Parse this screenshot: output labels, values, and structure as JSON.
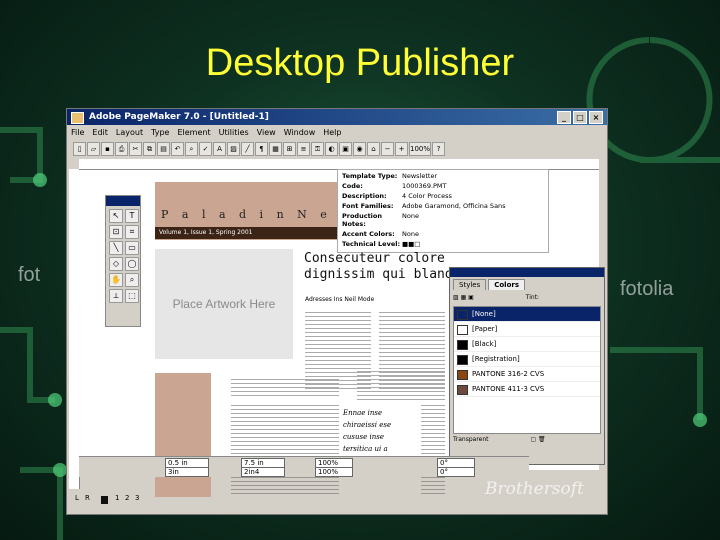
{
  "slide": {
    "title": "Desktop Publisher"
  },
  "watermarks": {
    "left": "fot",
    "right": "fotolia",
    "corner": "Brothersoft"
  },
  "window": {
    "title": "Adobe PageMaker 7.0 - [Untitled-1]"
  },
  "menu": [
    "File",
    "Edit",
    "Layout",
    "Type",
    "Element",
    "Utilities",
    "View",
    "Window",
    "Help"
  ],
  "ruler": {
    "zoom": "100%"
  },
  "toolbox": {
    "tools": [
      "↖",
      "T",
      "⊡",
      "⌗",
      "╲",
      "▭",
      "◇",
      "◯",
      "✋",
      "⌕",
      "⟂",
      "⬚"
    ]
  },
  "newsletter": {
    "name": "P a l a d i n  N e w",
    "volume": "Volume 1, Issue 1, Spring 2001",
    "placeholder": "Place Artwork Here",
    "headline_1": "Consecuteur colore",
    "headline_2": "dignissim qui bland",
    "byline": "Adresses Ins Neil Mode",
    "pull_quote": "Ennae inse chiraeissi ese cususe inse tersitica ui a"
  },
  "template_info": {
    "rows": [
      {
        "k": "Template Type:",
        "v": "Newsletter"
      },
      {
        "k": "Code:",
        "v": "1000369.PMT"
      },
      {
        "k": "Description:",
        "v": "4 Color Process"
      },
      {
        "k": "Font Families:",
        "v": "Adobe Garamond, Officina Sans"
      },
      {
        "k": "Production Notes:",
        "v": "None"
      },
      {
        "k": "Accent Colors:",
        "v": "None"
      },
      {
        "k": "Technical Level:",
        "v": "■■□"
      }
    ]
  },
  "colors_panel": {
    "tabs": [
      "Styles",
      "Colors"
    ],
    "tint_label": "Tint:",
    "swatches": [
      {
        "label": "[None]",
        "color": "#ffffff",
        "selected": true
      },
      {
        "label": "[Paper]",
        "color": "#ffffff",
        "selected": false
      },
      {
        "label": "[Black]",
        "color": "#000000",
        "selected": false
      },
      {
        "label": "[Registration]",
        "color": "#000000",
        "selected": false
      },
      {
        "label": "PANTONE 316-2 CVS",
        "color": "#8b4513",
        "selected": false
      },
      {
        "label": "PANTONE 411-3 CVS",
        "color": "#6e4a3c",
        "selected": false
      }
    ],
    "footer": "Transparent"
  },
  "control_palette": {
    "x": "0.5 in",
    "y": "3in",
    "w": "7.5 in",
    "h": "2in4",
    "scale_x": "100%",
    "scale_y": "100%",
    "rotate": "0°",
    "skew": "0°"
  },
  "status": {
    "pages": [
      "L",
      "R",
      "1",
      "2",
      "3"
    ]
  }
}
